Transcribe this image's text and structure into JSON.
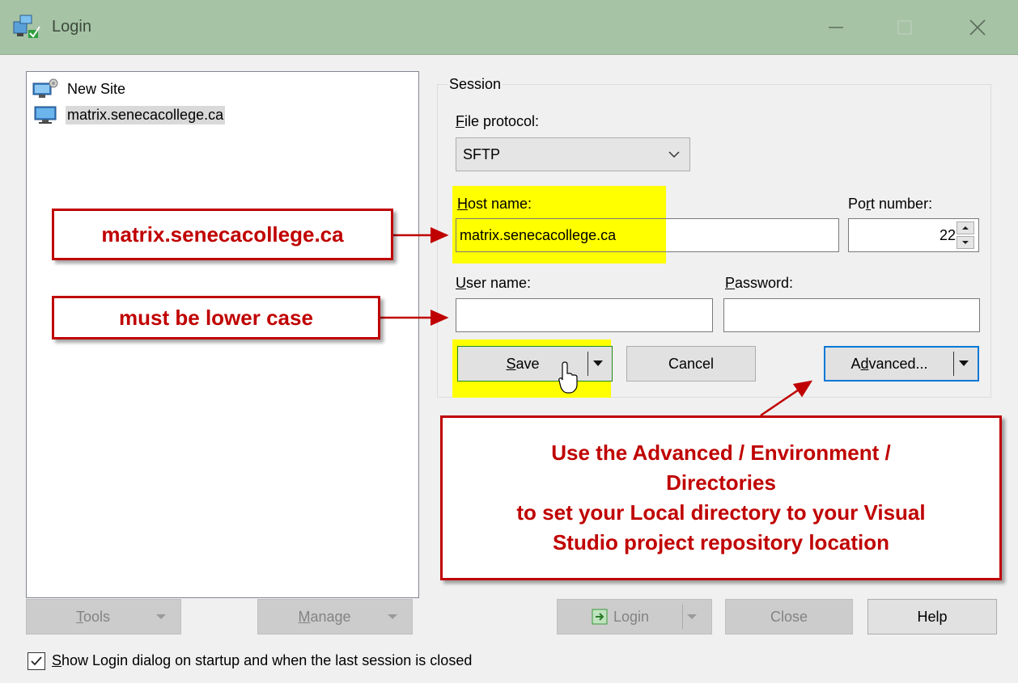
{
  "window": {
    "title": "Login"
  },
  "sites": [
    {
      "label": "New Site",
      "icon": "new-site-icon"
    },
    {
      "label": "matrix.senecacollege.ca",
      "icon": "computer-icon",
      "selected": true
    }
  ],
  "session": {
    "group_label": "Session",
    "file_protocol": {
      "label_accel": "F",
      "label_rest": "ile protocol:",
      "value": "SFTP"
    },
    "host": {
      "label_accel": "H",
      "label_rest": "ost name:",
      "value": "matrix.senecacollege.ca"
    },
    "port": {
      "label_pre": "Po",
      "label_accel": "r",
      "label_rest": "t number:",
      "value": "22"
    },
    "user": {
      "label_accel": "U",
      "label_rest": "ser name:",
      "value": ""
    },
    "password": {
      "label_accel": "P",
      "label_rest": "assword:",
      "value": ""
    },
    "save": {
      "label_accel": "S",
      "label_rest": "ave"
    },
    "cancel_label": "Cancel",
    "advanced": {
      "label_pre": "A",
      "label_accel": "d",
      "label_rest": "vanced..."
    }
  },
  "bottom": {
    "tools": {
      "label_accel": "T",
      "label_rest": "ools"
    },
    "manage": {
      "label_accel": "M",
      "label_rest": "anage"
    },
    "login_label": "Login",
    "close_label": "Close",
    "help_label": "Help",
    "startup_checkbox": {
      "checked": true,
      "label_accel": "S",
      "label_rest": "how Login dialog on startup and when the last session is closed"
    }
  },
  "annotations": {
    "host_callout": "matrix.senecacollege.ca",
    "user_callout": "must be lower case",
    "advanced_callout": [
      "Use the Advanced / Environment /",
      "Directories",
      "to set your Local directory to your Visual",
      "Studio project repository location"
    ]
  },
  "colors": {
    "annotation_red": "#c00000",
    "highlight_yellow": "#ffff00",
    "titlebar": "#a6c3a6"
  }
}
